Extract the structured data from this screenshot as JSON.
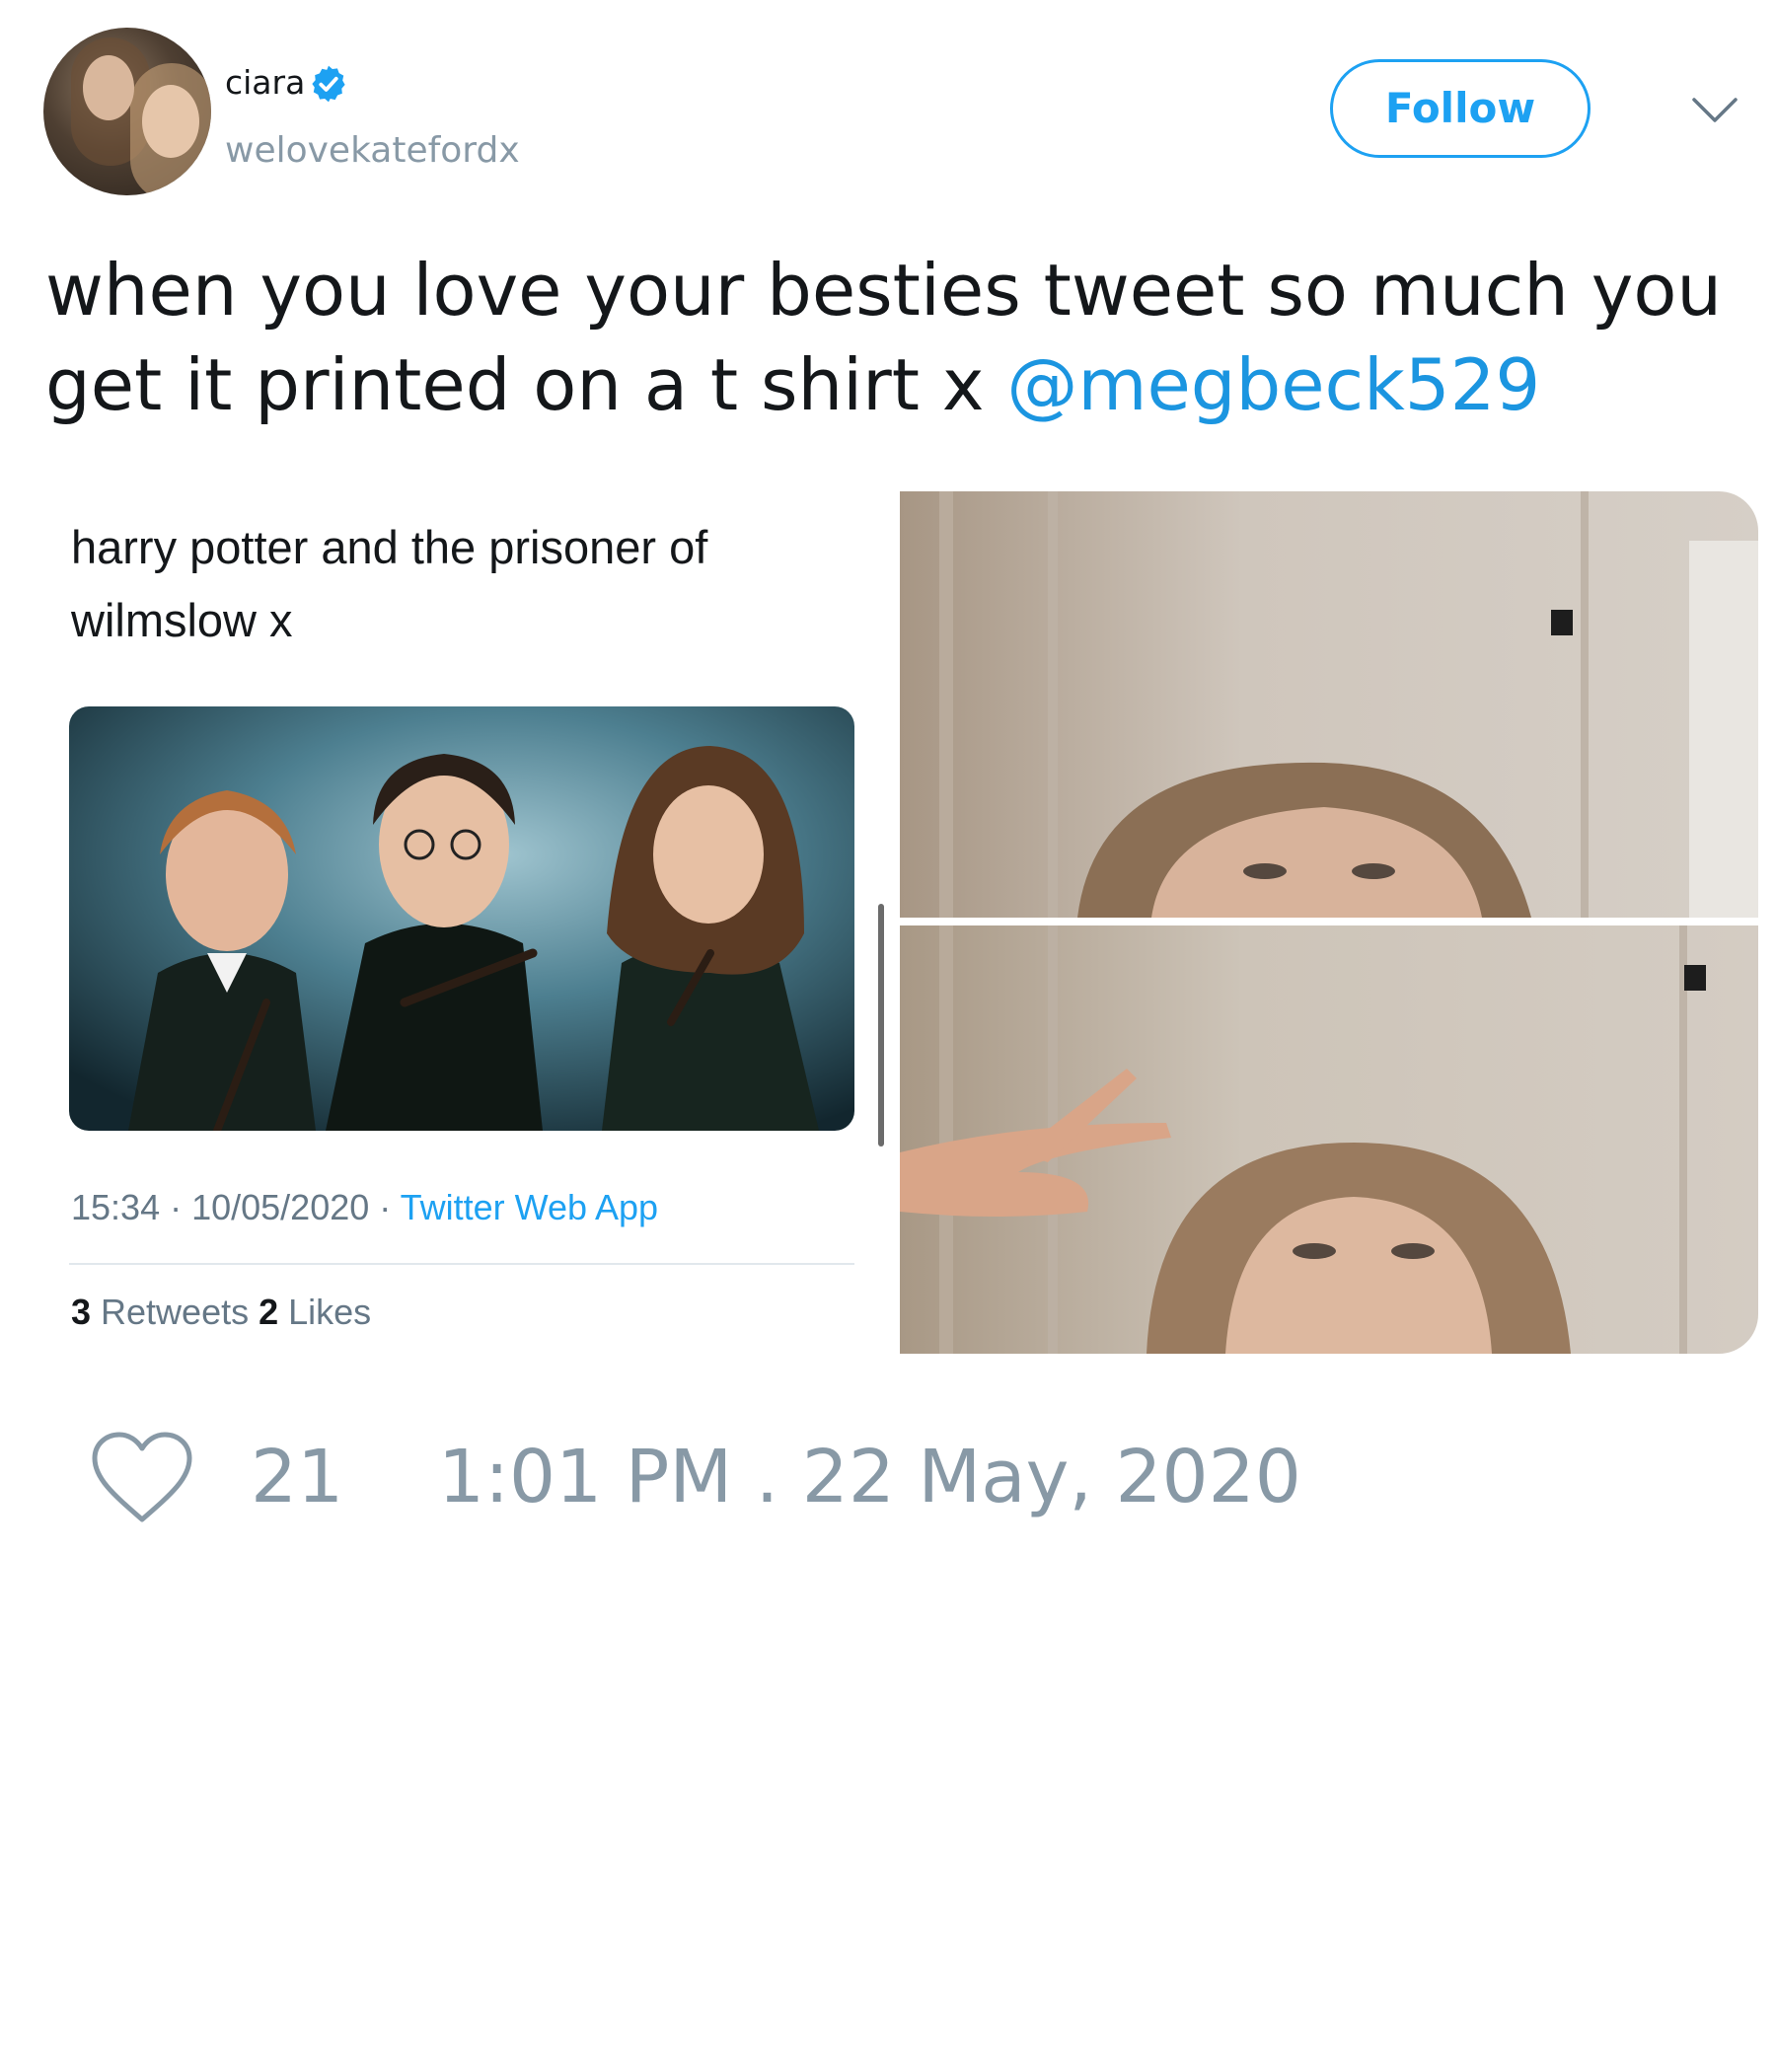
{
  "author": {
    "display_name": "ciara",
    "handle": "welovekatefordx",
    "verified": true
  },
  "actions": {
    "follow_label": "Follow"
  },
  "tweet": {
    "text": "when you love your besties tweet so much you get it printed on a t shirt x ",
    "mention": "@megbeck529"
  },
  "quoted": {
    "text": "harry potter and the prisoner of wilmslow x",
    "time": "15:34",
    "date": "10/05/2020",
    "separator": " · ",
    "source": "Twitter Web App",
    "retweets_count": "3",
    "retweets_label": " Retweets ",
    "likes_count": "2",
    "likes_label": " Likes"
  },
  "footer": {
    "like_count": "21",
    "timestamp": "1:01 PM . 22 May, 2020"
  },
  "colors": {
    "accent": "#1da1f2",
    "mention": "#1b95e0",
    "secondary_text": "#8899a6"
  }
}
